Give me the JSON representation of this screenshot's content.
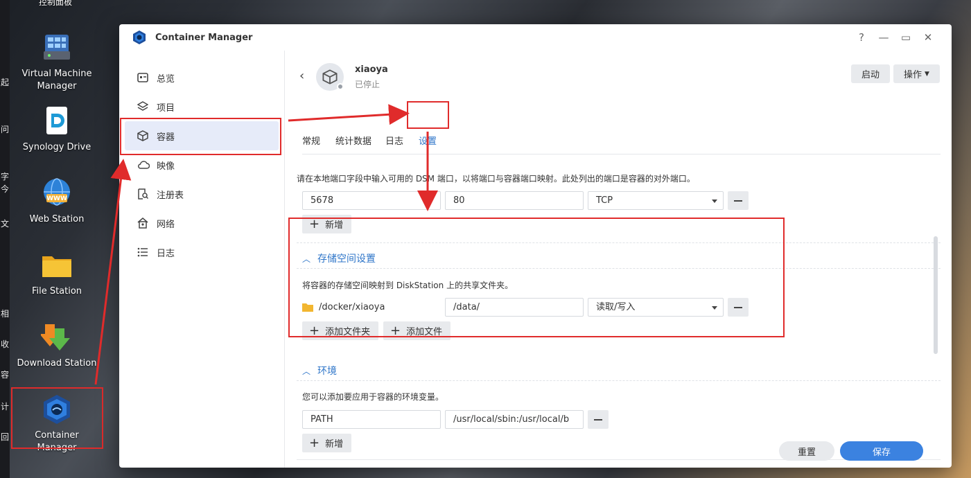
{
  "desktop": {
    "top_label": "控制面板",
    "icons": [
      {
        "label": "Virtual Machine Manager"
      },
      {
        "label": "Synology Drive"
      },
      {
        "label": "Web Station"
      },
      {
        "label": "File Station"
      },
      {
        "label": "Download Station"
      },
      {
        "label": "Container Manager"
      }
    ],
    "strip_chars": [
      "起",
      "问",
      "字",
      "今",
      "文",
      "相",
      "收",
      "容",
      "计",
      "回"
    ]
  },
  "window": {
    "title": "Container Manager",
    "controls": {
      "help": "?",
      "minimize": "—",
      "maximize": "▭",
      "close": "✕"
    }
  },
  "sidebar": {
    "items": [
      {
        "label": "总览",
        "icon": "overview-icon"
      },
      {
        "label": "项目",
        "icon": "project-layers-icon"
      },
      {
        "label": "容器",
        "icon": "container-cube-icon",
        "active": true
      },
      {
        "label": "映像",
        "icon": "image-cloud-icon"
      },
      {
        "label": "注册表",
        "icon": "registry-search-icon"
      },
      {
        "label": "网络",
        "icon": "network-home-icon"
      },
      {
        "label": "日志",
        "icon": "log-list-icon"
      }
    ]
  },
  "container": {
    "name": "xiaoya",
    "status": "已停止",
    "start_label": "启动",
    "action_label": "操作"
  },
  "tabs": [
    {
      "label": "常规"
    },
    {
      "label": "统计数据"
    },
    {
      "label": "日志"
    },
    {
      "label": "设置",
      "active": true
    }
  ],
  "ports": {
    "description": "请在本地端口字段中输入可用的 DSM 端口，以将端口与容器端口映射。此处列出的端口是容器的对外端口。",
    "rows": [
      {
        "local": "5678",
        "container": "80",
        "protocol": "TCP"
      }
    ],
    "add_label": "新增"
  },
  "storage": {
    "title": "存储空间设置",
    "description": "将容器的存储空间映射到 DiskStation 上的共享文件夹。",
    "rows": [
      {
        "folder": "/docker/xiaoya",
        "mount": "/data/",
        "permission": "读取/写入"
      }
    ],
    "add_folder_label": "添加文件夹",
    "add_file_label": "添加文件"
  },
  "environment": {
    "title": "环境",
    "description": "您可以添加要应用于容器的环境变量。",
    "rows": [
      {
        "key": "PATH",
        "value": "/usr/local/sbin:/usr/local/b"
      }
    ],
    "add_label": "新增"
  },
  "footer": {
    "reset_label": "重置",
    "save_label": "保存"
  },
  "colors": {
    "accent": "#2f76c9",
    "primary_button": "#3b82e0",
    "annotation_red": "#e02b2b"
  }
}
